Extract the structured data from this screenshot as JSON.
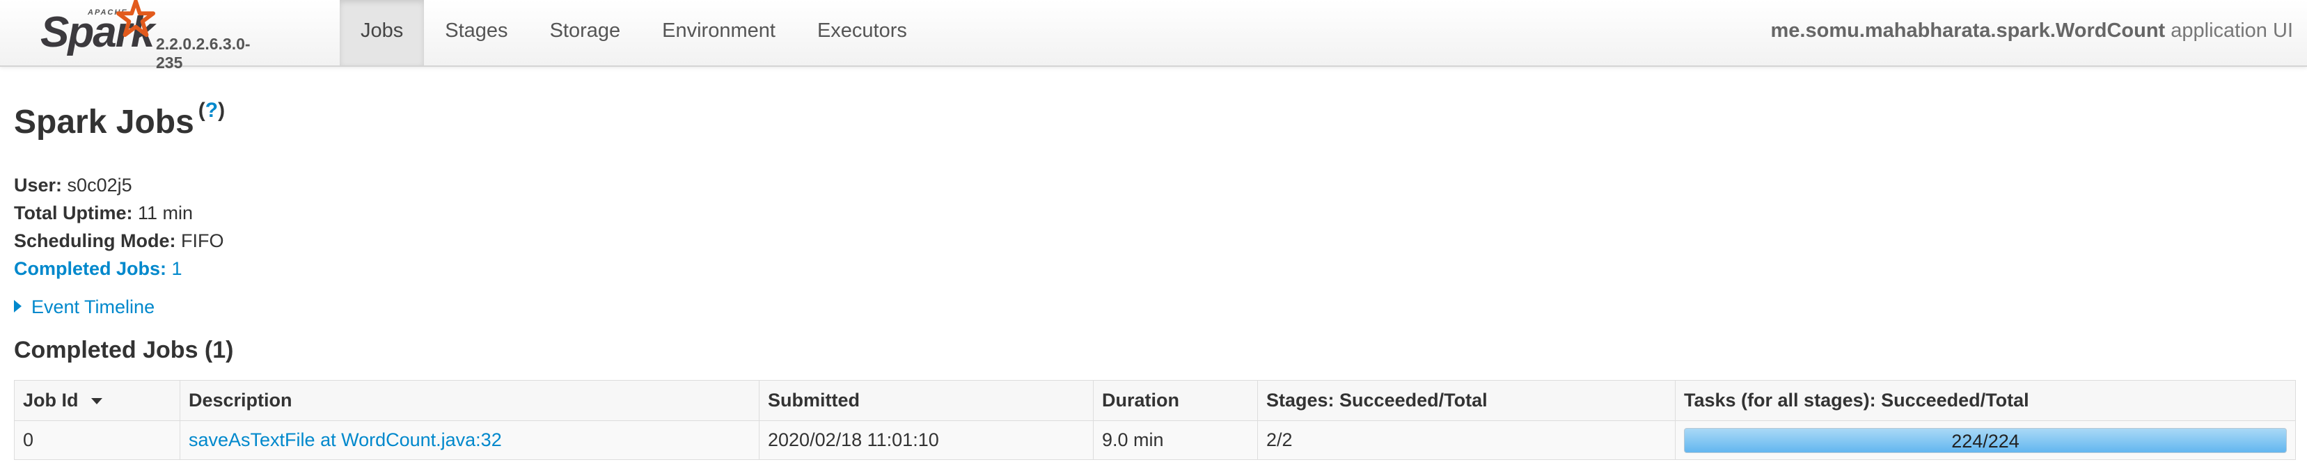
{
  "brand": {
    "apache": "APACHE",
    "word": "Spark",
    "version": "2.2.0.2.6.3.0-235"
  },
  "nav": {
    "tabs": [
      "Jobs",
      "Stages",
      "Storage",
      "Environment",
      "Executors"
    ],
    "active": "Jobs"
  },
  "app_title": {
    "name": "me.somu.mahabharata.spark.WordCount",
    "suffix": "application UI"
  },
  "page": {
    "title": "Spark Jobs",
    "help_open": "(",
    "help_mark": "?",
    "help_close": ")"
  },
  "summary": {
    "user_label": "User:",
    "user": "s0c02j5",
    "uptime_label": "Total Uptime:",
    "uptime": "11 min",
    "mode_label": "Scheduling Mode:",
    "mode": "FIFO",
    "completed_label": "Completed Jobs:",
    "completed": "1"
  },
  "timeline": {
    "label": "Event Timeline"
  },
  "completed_section": {
    "title": "Completed Jobs (1)"
  },
  "table": {
    "headers": [
      "Job Id",
      "Description",
      "Submitted",
      "Duration",
      "Stages: Succeeded/Total",
      "Tasks (for all stages): Succeeded/Total"
    ],
    "rows": [
      {
        "job_id": "0",
        "description": "saveAsTextFile at WordCount.java:32",
        "submitted": "2020/02/18 11:01:10",
        "duration": "9.0 min",
        "stages": "2/2",
        "tasks": "224/224",
        "tasks_progress": 1.0
      }
    ]
  },
  "colors": {
    "link": "#0088cc",
    "progress": "#63b6ef",
    "nav_active": "#e5e5e5"
  }
}
